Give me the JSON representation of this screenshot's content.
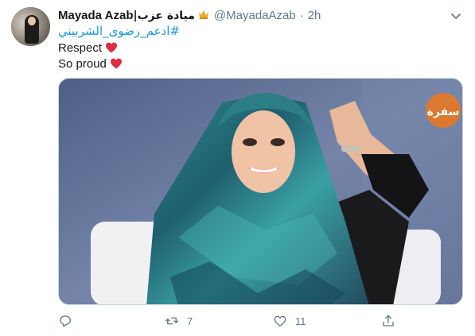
{
  "tweet": {
    "author": {
      "name_latin": "Mayada Azab",
      "name_arabic": "|ميادة عزب",
      "badge_icon": "crown-icon",
      "handle": "@MayadaAzab",
      "separator": "·",
      "time": "2h"
    },
    "body": {
      "hashtag": "#ادعم_رضوى_الشربيني",
      "line1": "Respect",
      "line2": "So proud"
    },
    "actions": {
      "reply_count": "",
      "retweet_count": "7",
      "like_count": "11"
    }
  },
  "colors": {
    "link": "#1b95e0",
    "muted": "#657786",
    "heart": "#e0245e",
    "border": "#ccd6dd",
    "text": "#14171a"
  },
  "media": {
    "channel_logo_text": "سفرة",
    "logo_color": "#e87722"
  }
}
